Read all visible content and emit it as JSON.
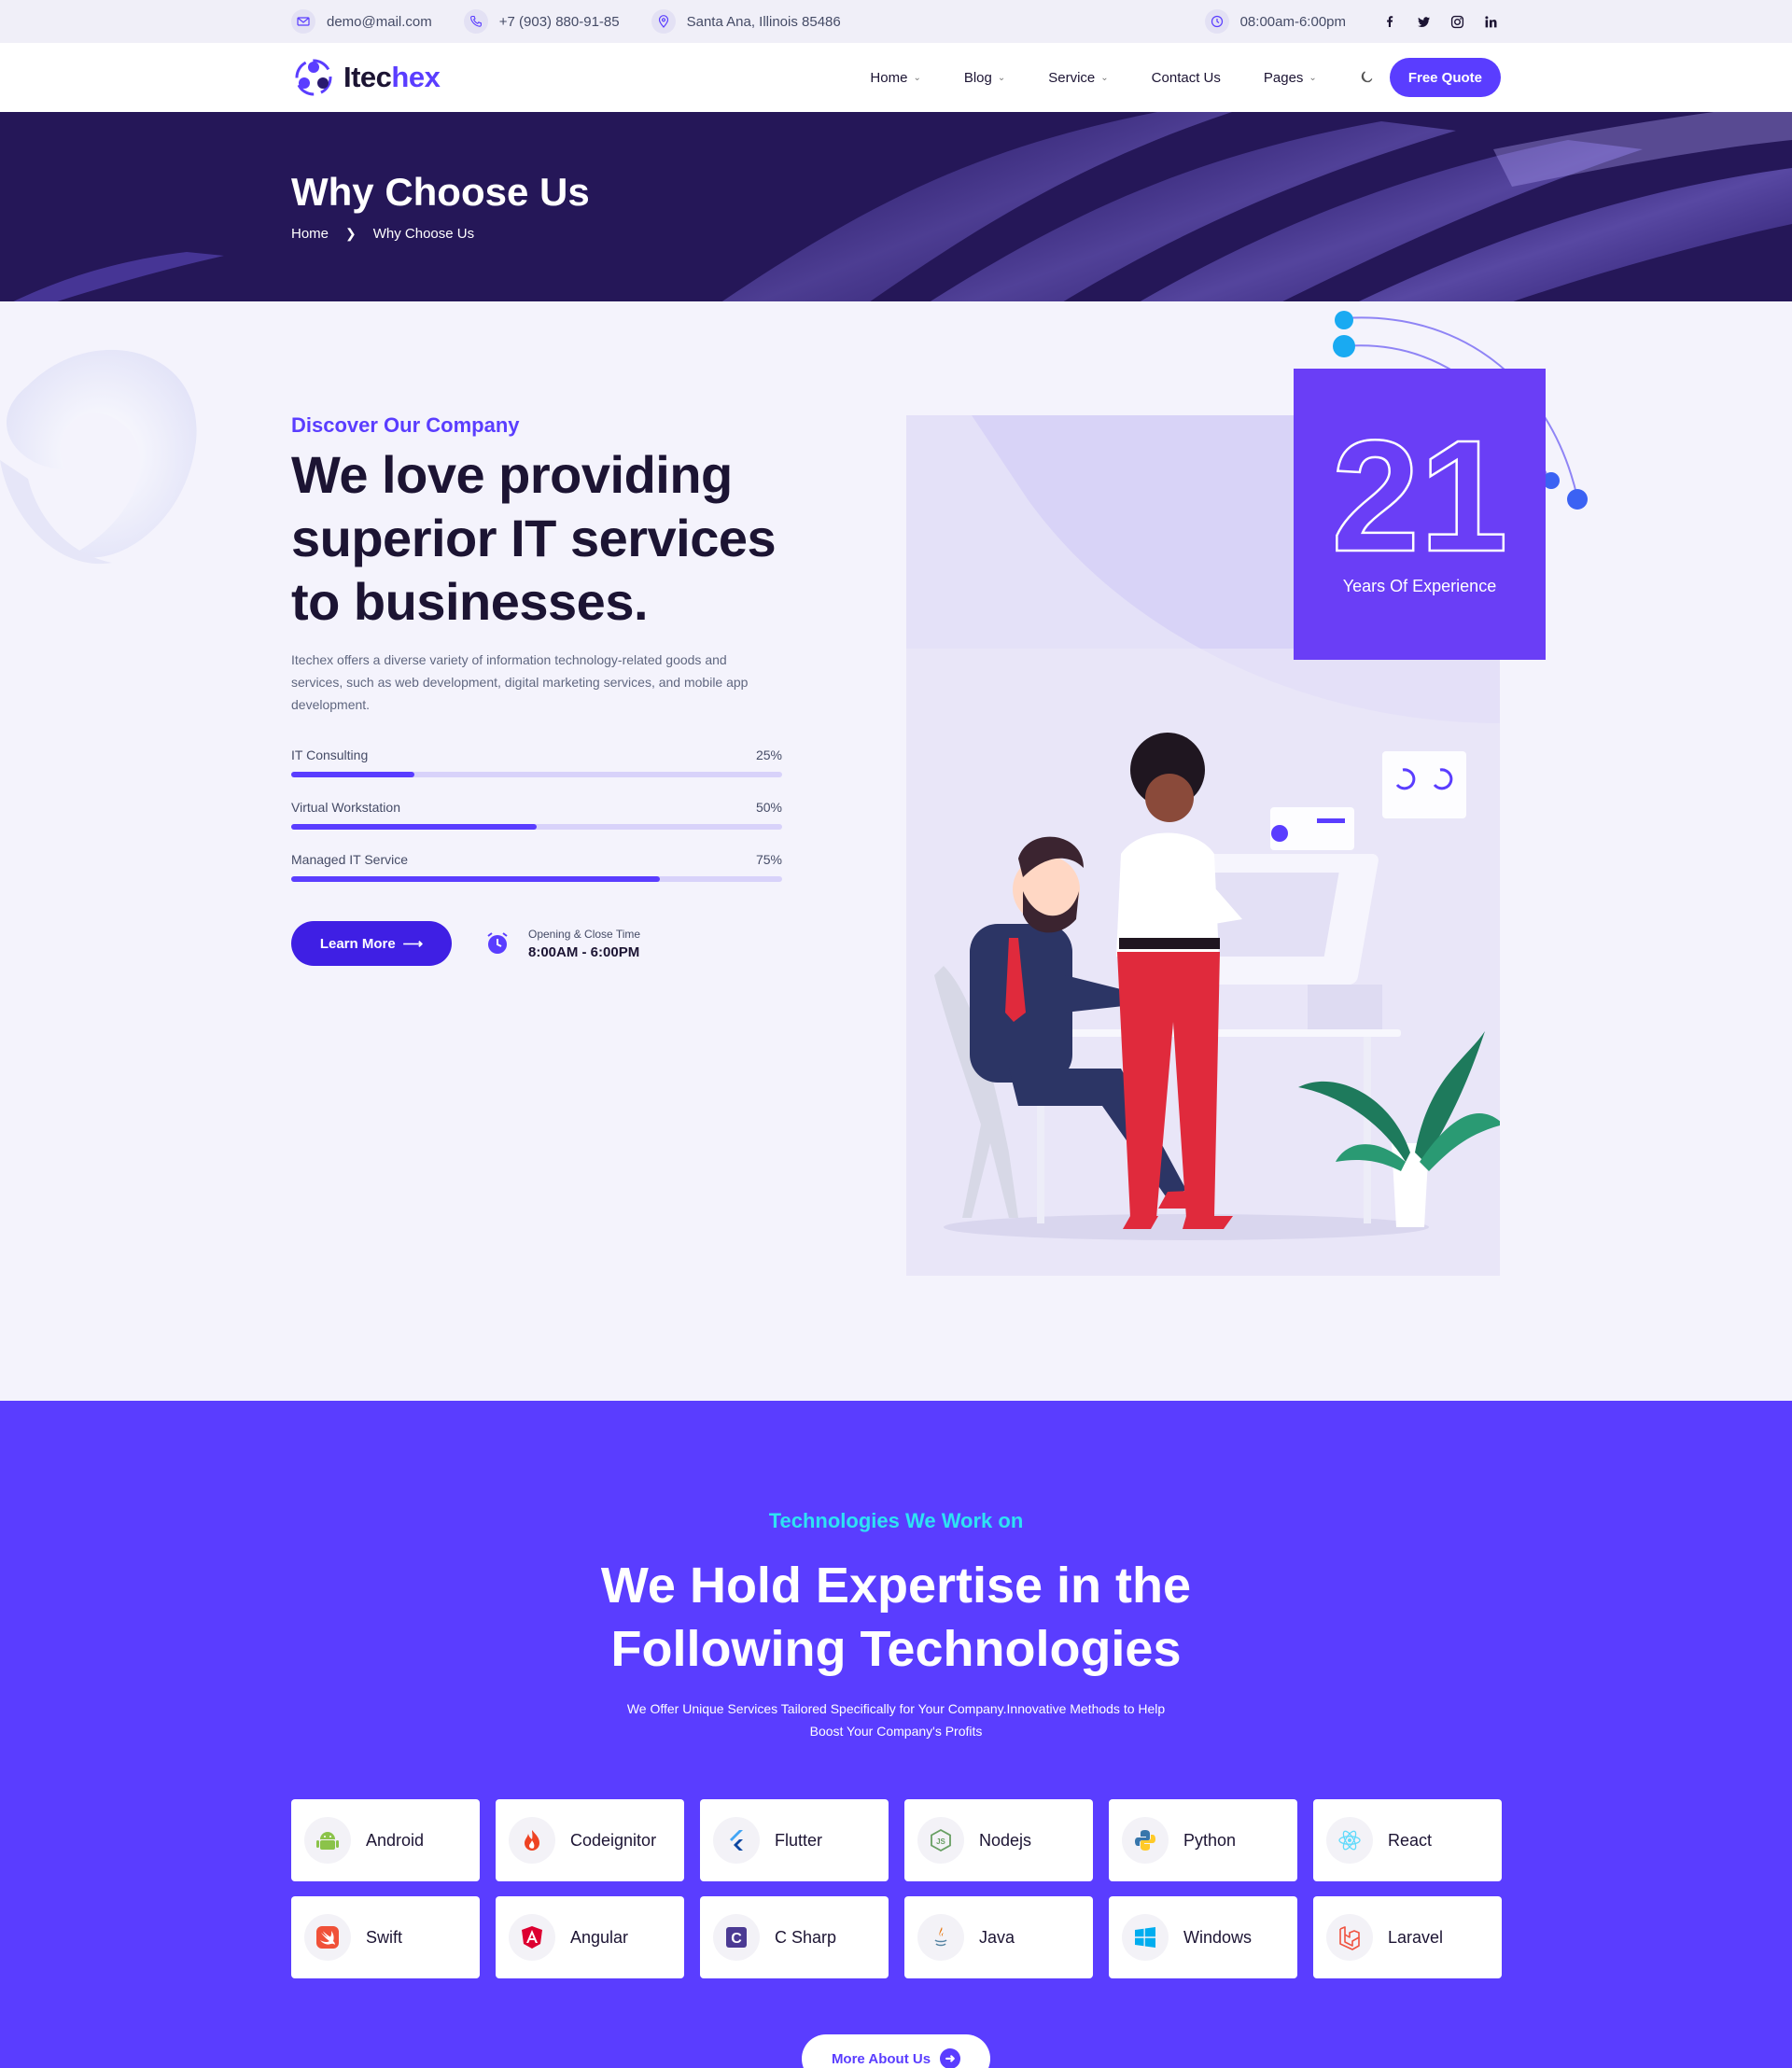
{
  "topbar": {
    "email": "demo@mail.com",
    "phone": "+7 (903) 880-91-85",
    "address": "Santa Ana, Illinois 85486",
    "hours": "08:00am-6:00pm",
    "social": [
      "facebook-icon",
      "twitter-icon",
      "instagram-icon",
      "linkedin-icon"
    ]
  },
  "nav": {
    "logo_prefix": "Itec",
    "logo_accent": "hex",
    "items": [
      {
        "label": "Home",
        "dropdown": true
      },
      {
        "label": "Blog",
        "dropdown": true
      },
      {
        "label": "Service",
        "dropdown": true
      },
      {
        "label": "Contact Us",
        "dropdown": false
      },
      {
        "label": "Pages",
        "dropdown": true
      }
    ],
    "cta": "Free Quote"
  },
  "hero": {
    "title": "Why Choose Us",
    "breadcrumb": [
      "Home",
      "Why Choose Us"
    ]
  },
  "about": {
    "kicker": "Discover Our Company",
    "headline": "We love providing superior IT services to businesses.",
    "description": "Itechex offers a diverse variety of information technology-related goods and services, such as web development, digital marketing services, and mobile app development.",
    "skills": [
      {
        "label": "IT Consulting",
        "percent_text": "25%",
        "value": 25
      },
      {
        "label": "Virtual Workstation",
        "percent_text": "50%",
        "value": 50
      },
      {
        "label": "Managed IT Service",
        "percent_text": "75%",
        "value": 75
      }
    ],
    "cta": "Learn More",
    "hours_label": "Opening & Close Time",
    "hours_value": "8:00AM - 6:00PM",
    "experience_number": "21",
    "experience_label": "Years Of Experience"
  },
  "tech": {
    "kicker": "Technologies We Work on",
    "title_line1": "We Hold Expertise in the",
    "title_line2": "Following Technologies",
    "subtitle": "We Offer Unique Services Tailored Specifically for Your Company.Innovative Methods to Help Boost Your Company's Profits",
    "items": [
      {
        "name": "Android",
        "icon": "android-icon"
      },
      {
        "name": "Codeignitor",
        "icon": "codeigniter-icon"
      },
      {
        "name": "Flutter",
        "icon": "flutter-icon"
      },
      {
        "name": "Nodejs",
        "icon": "nodejs-icon"
      },
      {
        "name": "Python",
        "icon": "python-icon"
      },
      {
        "name": "React",
        "icon": "react-icon"
      },
      {
        "name": "Swift",
        "icon": "swift-icon"
      },
      {
        "name": "Angular",
        "icon": "angular-icon"
      },
      {
        "name": "C Sharp",
        "icon": "csharp-icon"
      },
      {
        "name": "Java",
        "icon": "java-icon"
      },
      {
        "name": "Windows",
        "icon": "windows-icon"
      },
      {
        "name": "Laravel",
        "icon": "laravel-icon"
      }
    ],
    "more_button": "More About Us"
  },
  "colors": {
    "accent": "#5a3dff",
    "hero_bg": "#251758",
    "kicker_cyan": "#2ee3f3",
    "experience_box": "#6a3ef6"
  }
}
